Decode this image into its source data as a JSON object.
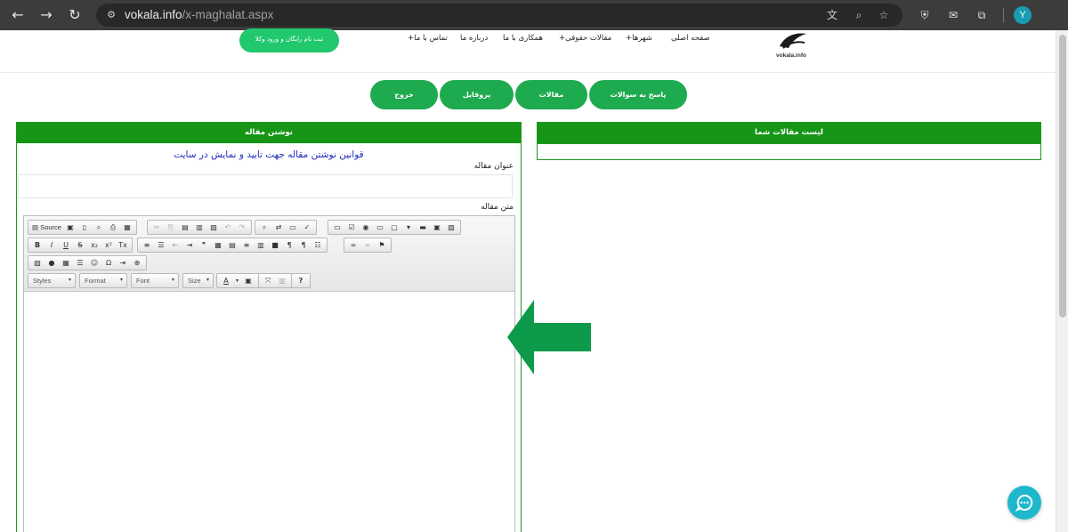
{
  "browser": {
    "url_host": "vokala.info",
    "url_path": "/x-maghalat.aspx",
    "profile_initial": "Y"
  },
  "header": {
    "logo_text": "vokala.info",
    "nav": [
      {
        "label": "صفحه اصلی"
      },
      {
        "label": "شهرها+"
      },
      {
        "label": "مقالات حقوقی+"
      },
      {
        "label": "همکاری با ما"
      },
      {
        "label": "درباره ما"
      },
      {
        "label": "تماس با ما+"
      }
    ],
    "register_label": "ثبت نام رایگان و ورود وکلا"
  },
  "actions": {
    "answer_questions": "پاسخ به سوالات",
    "articles": "مقالات",
    "profile": "پروفایل",
    "logout": "خروج"
  },
  "articles_list": {
    "title": "لیست مقالات شما"
  },
  "write_article": {
    "title": "نوشتن مقاله",
    "rules_link": "قوانین نوشتن مقاله جهت تایید و نمایش در سایت",
    "title_label": "عنوان مقاله",
    "title_value": "",
    "body_label": "متن مقاله"
  },
  "editor": {
    "source_label": "Source",
    "combos": {
      "styles": "Styles",
      "format": "Format",
      "font": "Font",
      "size": "Size"
    }
  },
  "colors": {
    "panel_green": "#169516",
    "button_green": "#1eaa4f",
    "register_green": "#21c86d",
    "arrow_green": "#0d9a4a",
    "chat_teal": "#1fb7cc",
    "link_blue": "#1f2bb8"
  }
}
